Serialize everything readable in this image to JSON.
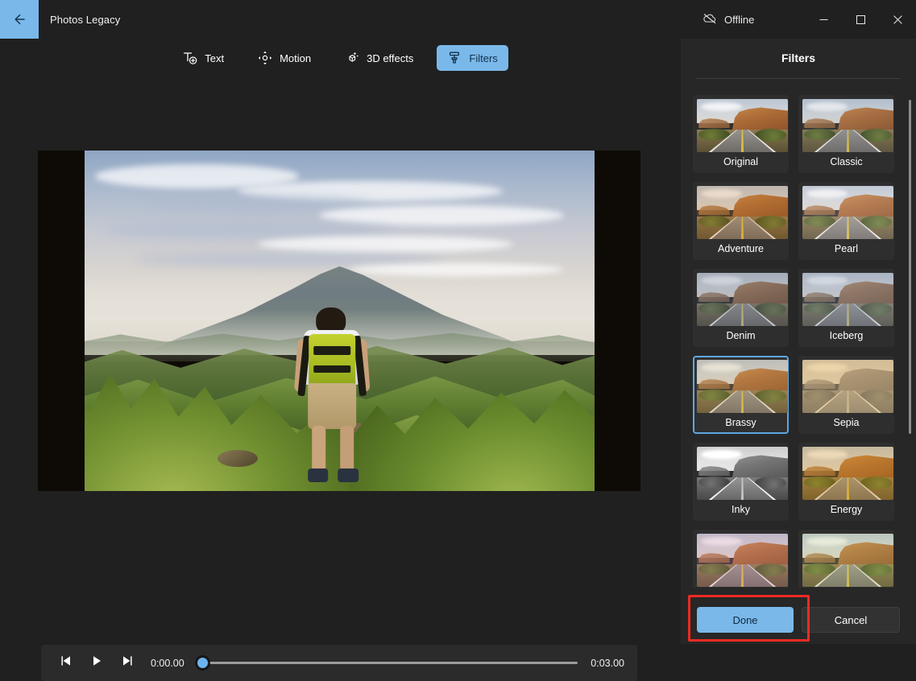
{
  "window": {
    "app_title": "Photos Legacy",
    "back_icon": "back-arrow-icon",
    "offline_label": "Offline",
    "offline_icon": "cloud-offline-icon",
    "minimize_icon": "minimize-icon",
    "maximize_icon": "maximize-icon",
    "close_icon": "close-icon",
    "accent_color": "#7ab8ea",
    "background_color": "#202020"
  },
  "toolbar": {
    "items": [
      {
        "label": "Text",
        "icon": "text-add-icon",
        "active": false
      },
      {
        "label": "Motion",
        "icon": "motion-icon",
        "active": false
      },
      {
        "label": "3D effects",
        "icon": "3d-effects-icon",
        "active": false
      },
      {
        "label": "Filters",
        "icon": "filters-brush-icon",
        "active": true
      }
    ]
  },
  "preview": {
    "description": "Hiker with green backpack facing a volcano",
    "letterbox_color": "#0e0b06"
  },
  "player": {
    "prev_frame_icon": "previous-frame-icon",
    "play_icon": "play-icon",
    "next_frame_icon": "next-frame-icon",
    "current_time": "0:00.00",
    "total_time": "0:03.00",
    "progress_percent": 0
  },
  "panel": {
    "title": "Filters",
    "scrollbar": "vertical-scrollbar",
    "filters": [
      {
        "name": "Original",
        "selected": false,
        "tint": "none"
      },
      {
        "name": "Classic",
        "selected": false,
        "tint": "rgba(120,140,170,0.10)"
      },
      {
        "name": "Adventure",
        "selected": false,
        "tint": "rgba(205,120,30,0.20)"
      },
      {
        "name": "Pearl",
        "selected": false,
        "tint": "rgba(235,225,230,0.16)"
      },
      {
        "name": "Denim",
        "selected": false,
        "tint": "rgba(70,95,140,0.22)"
      },
      {
        "name": "Iceberg",
        "selected": false,
        "tint": "rgba(110,140,190,0.26)"
      },
      {
        "name": "Brassy",
        "selected": true,
        "tint": "rgba(200,165,95,0.22)"
      },
      {
        "name": "Sepia",
        "selected": false,
        "tint": "rgba(150,130,105,0.55)"
      },
      {
        "name": "Inky",
        "selected": false,
        "tint": "grayscale"
      },
      {
        "name": "Energy",
        "selected": false,
        "tint": "rgba(225,150,20,0.28)"
      },
      {
        "name": "",
        "selected": false,
        "tint": "rgba(215,130,160,0.22)"
      },
      {
        "name": "",
        "selected": false,
        "tint": "rgba(195,205,120,0.22)"
      }
    ]
  },
  "footer": {
    "done_label": "Done",
    "cancel_label": "Cancel",
    "highlight_color": "#ef2b23",
    "highlighted_button": "Done"
  }
}
